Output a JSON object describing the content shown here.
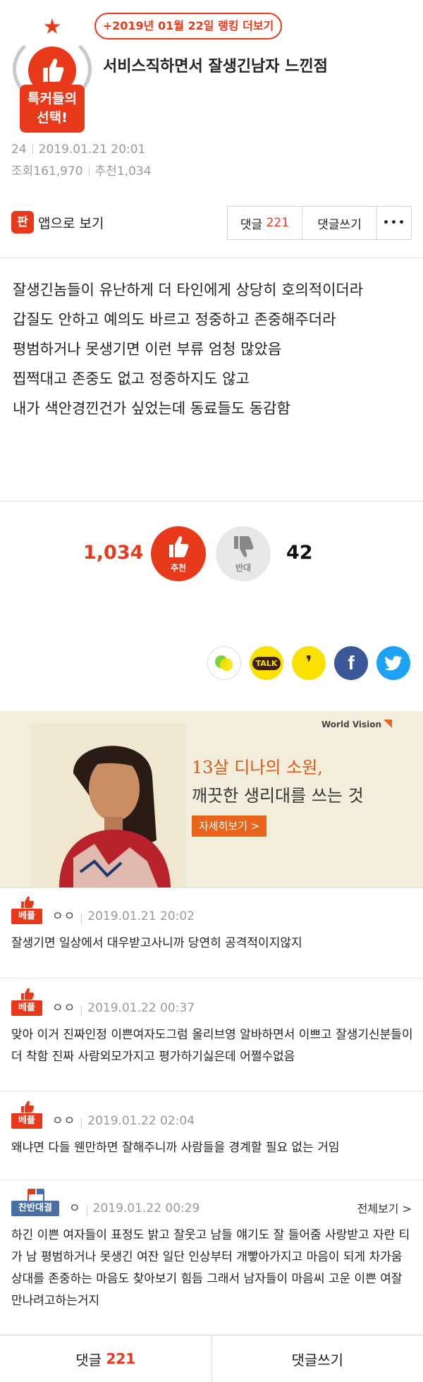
{
  "badge": {
    "line1": "톡커들의",
    "line2": "선택!"
  },
  "ranking_link": "+2019년 01월 22일 랭킹 더보기",
  "post": {
    "title": "서비스직하면서 잘생긴남자 느낀점",
    "author_level": "24",
    "datetime": "2019.01.21 20:01",
    "views": "조회161,970",
    "recommends": "추천1,034",
    "body": [
      "잘생긴놈들이 유난하게 더 타인에게 상당히 호의적이더라",
      "갑질도 안하고 예의도 바르고 정중하고 존중해주더라",
      "평범하거나 못생기면 이런 부류 엄청 많았음",
      "찝쩍대고 존중도 없고 정중하지도 않고",
      "내가 색안경낀건가 싶었는데 동료들도 동감함"
    ]
  },
  "actions": {
    "app_icon": "판",
    "app_view": "앱으로 보기",
    "comment_label": "댓글",
    "comment_count": "221",
    "write": "댓글쓰기",
    "more": "•••"
  },
  "votes": {
    "up_count": "1,034",
    "up_label": "추천",
    "down_label": "반대",
    "down_count": "42"
  },
  "share": {
    "icons": [
      "kakaostory-icon",
      "kakaotalk-icon",
      "story-icon",
      "facebook-icon",
      "twitter-icon"
    ],
    "talk_label": "TALK",
    "facebook_glyph": "f",
    "story_glyph": "❜"
  },
  "ad": {
    "brand": "World Vision",
    "title1": "13살 디나의 소원,",
    "title2": "깨끗한 생리대를 쓰는 것",
    "cta": "자세히보기 >"
  },
  "comments": [
    {
      "badge": "베플",
      "author": "ㅇㅇ",
      "date": "2019.01.21 20:02",
      "text": "잘생기면 일상에서 대우받고사니까 당연히 공격적이지않지"
    },
    {
      "badge": "베플",
      "author": "ㅇㅇ",
      "date": "2019.01.22 00:37",
      "text": "맞아 이거 진짜인정 이쁜여자도그럼 올리브영 알바하면서 이쁘고 잘생기신분들이 더 착함 진짜 사람외모가지고 평가하기싫은데 어쩔수없음"
    },
    {
      "badge": "베플",
      "author": "ㅇㅇ",
      "date": "2019.01.22 02:04",
      "text": "왜냐면 다들 웬만하면 잘해주니까 사람들을 경계할 필요 없는 거임"
    },
    {
      "badge": "찬반대결",
      "author": "ㅇ",
      "date": "2019.01.22 00:29",
      "more": "전체보기 >",
      "text": "하긴 이쁜 여자들이 표정도 밝고 잘웃고 남들 얘기도 잘 들어줌 사랑받고 자란 티가 남 평범하거나 못생긴 여잔 일단 인상부터 개빻아가지고 마음이 되게 차가움 상대를 존중하는 마음도 찾아보기 힘듬 그래서 남자들이 마음씨 고운 이쁜 여잘 만나려고하는거지"
    }
  ],
  "bottom": {
    "comment_label": "댓글",
    "comment_count": "221",
    "write": "댓글쓰기"
  },
  "colors": {
    "accent": "#e8391b",
    "rival": "#4a6fa5",
    "facebook": "#3b5998",
    "twitter": "#1da1f2",
    "kakao": "#fbe100"
  }
}
